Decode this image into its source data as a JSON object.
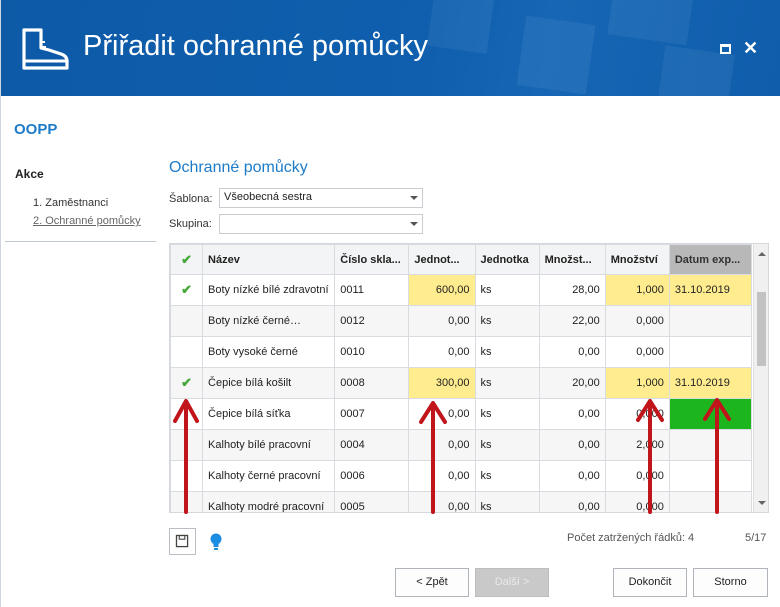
{
  "window": {
    "title": "Přiřadit ochranné pomůcky",
    "icon": "boot-icon",
    "controls": {
      "maximize_icon": "maximize-icon",
      "close_label": "✕"
    },
    "colors": {
      "header": "#0d5aa7",
      "accent": "#1e7bc8",
      "highlight_yellow": "#ffec8f",
      "highlight_green": "#1db51d",
      "check_green": "#46a73b",
      "arrow_red": "#c0151b"
    }
  },
  "sidebar": {
    "module": "OOPP",
    "heading": "Akce",
    "steps": [
      {
        "label": "1. Zaměstnanci",
        "active": false
      },
      {
        "label": "2. Ochranné pomůcky",
        "active": true
      }
    ]
  },
  "main": {
    "section_title": "Ochranné pomůcky",
    "fields": [
      {
        "label": "Šablona:",
        "value": "Všeobecná sestra"
      },
      {
        "label": "Skupina:",
        "value": ""
      }
    ],
    "grid": {
      "columns": [
        "✔",
        "Název",
        "Číslo skla...",
        "Jednot...",
        "Jednotka",
        "Množst...",
        "Množství",
        "Datum exp..."
      ],
      "rows": [
        {
          "checked": "✔",
          "name": "Boty nízké bílé zdravotní",
          "code": "0011",
          "unit_price": "600,00",
          "unit": "ks",
          "stock": "28,00",
          "qty": "1,000",
          "date": "31.10.2019",
          "yellow": true,
          "green_date": false
        },
        {
          "checked": "",
          "name": "Boty nízké černé…",
          "code": "0012",
          "unit_price": "0,00",
          "unit": "ks",
          "stock": "22,00",
          "qty": "0,000",
          "date": "",
          "yellow": false,
          "green_date": false
        },
        {
          "checked": "",
          "name": "Boty vysoké černé",
          "code": "0010",
          "unit_price": "0,00",
          "unit": "ks",
          "stock": "0,00",
          "qty": "0,000",
          "date": "",
          "yellow": false,
          "green_date": false
        },
        {
          "checked": "✔",
          "name": "Čepice bílá košilt",
          "code": "0008",
          "unit_price": "300,00",
          "unit": "ks",
          "stock": "20,00",
          "qty": "1,000",
          "date": "31.10.2019",
          "yellow": true,
          "green_date": false
        },
        {
          "checked": "",
          "name": "Čepice bílá síťka",
          "code": "0007",
          "unit_price": "0,00",
          "unit": "ks",
          "stock": "0,00",
          "qty": "0,000",
          "date": "",
          "yellow": false,
          "green_date": true
        },
        {
          "checked": "",
          "name": "Kalhoty bílé pracovní",
          "code": "0004",
          "unit_price": "0,00",
          "unit": "ks",
          "stock": "0,00",
          "qty": "2,000",
          "date": "",
          "yellow": false,
          "green_date": false
        },
        {
          "checked": "",
          "name": "Kalhoty černé pracovní",
          "code": "0006",
          "unit_price": "0,00",
          "unit": "ks",
          "stock": "0,00",
          "qty": "0,000",
          "date": "",
          "yellow": false,
          "green_date": false
        },
        {
          "checked": "",
          "name": "Kalhoty modré pracovní",
          "code": "0005",
          "unit_price": "0,00",
          "unit": "ks",
          "stock": "0,00",
          "qty": "0,000",
          "date": "",
          "yellow": false,
          "green_date": false
        }
      ]
    },
    "footer": {
      "save_icon": "save-icon",
      "hint_icon": "lightbulb-icon",
      "count_text": "Počet zatržených řádků: 4",
      "pages": "5/17"
    }
  },
  "buttons": {
    "back": "< Zpět",
    "next": "Další >",
    "finish": "Dokončit",
    "cancel": "Storno"
  }
}
